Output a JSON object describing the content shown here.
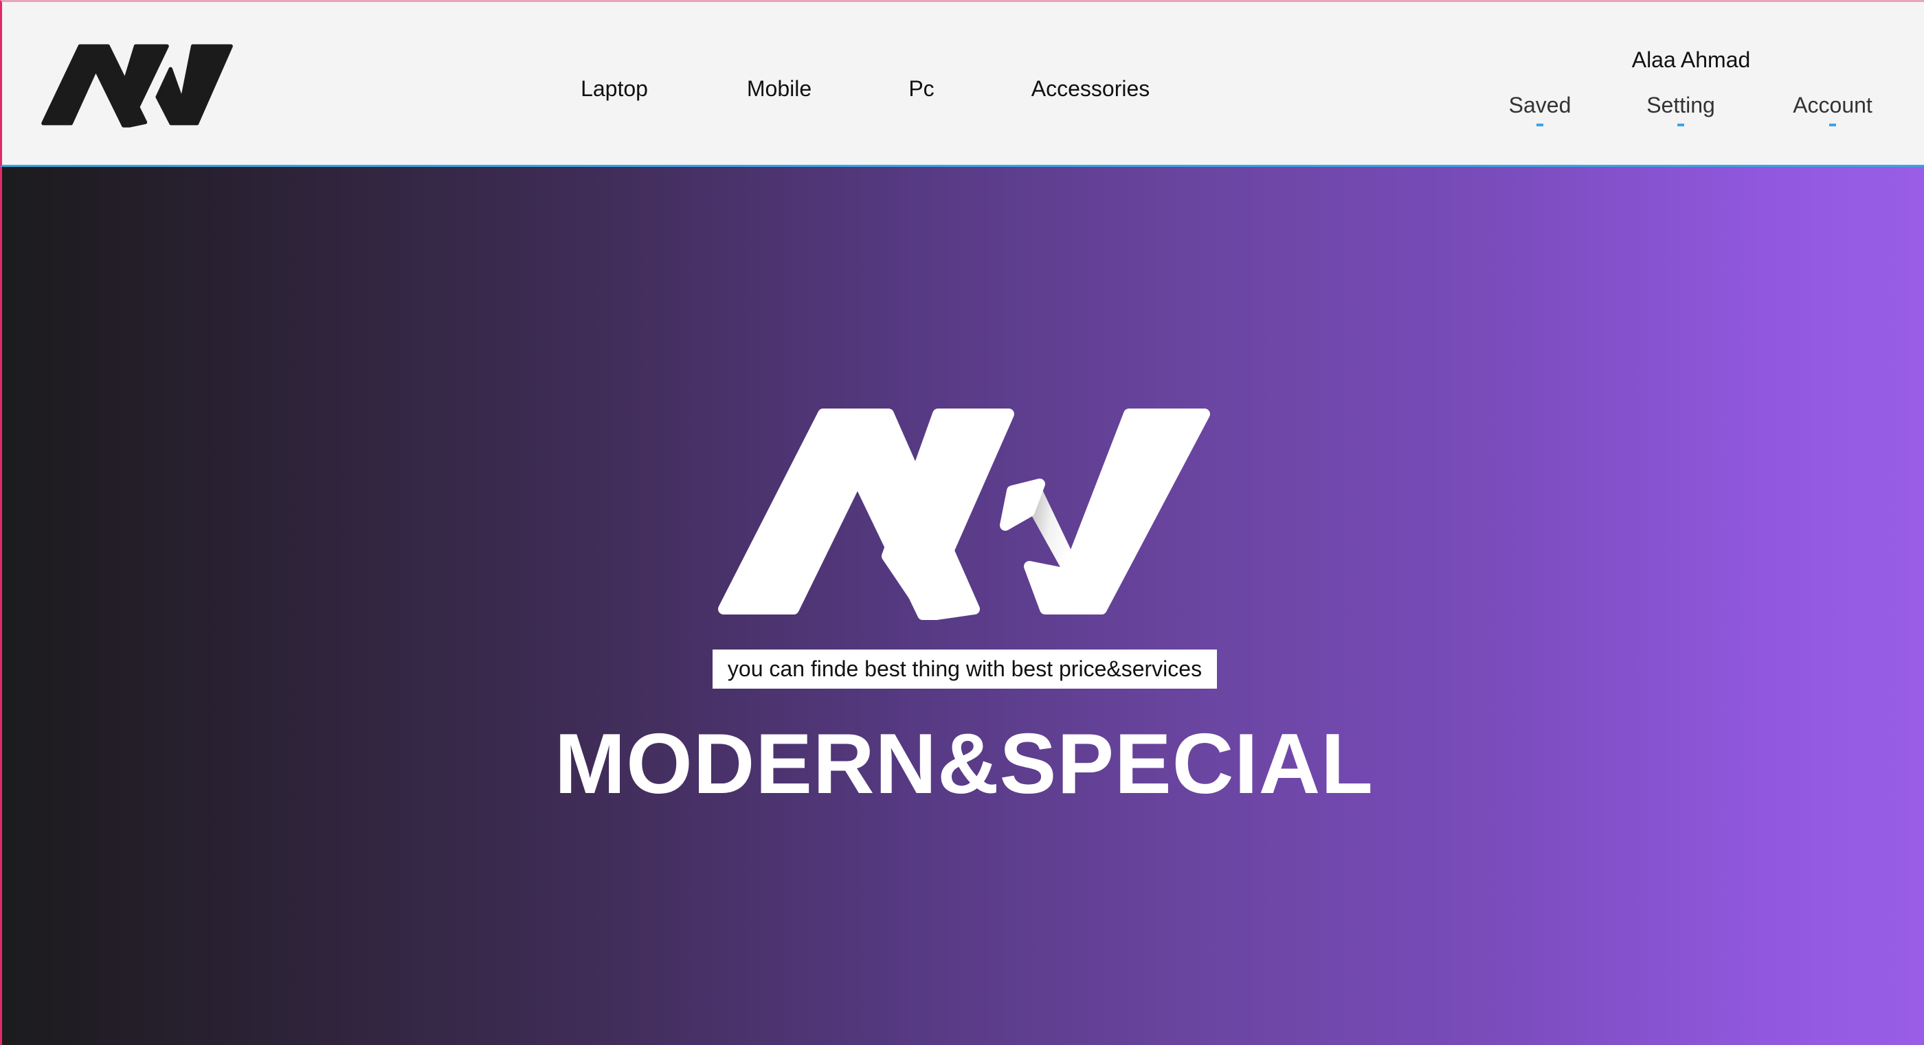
{
  "header": {
    "logo_icon": "nw-logo-icon",
    "nav": [
      {
        "label": "Laptop"
      },
      {
        "label": "Mobile"
      },
      {
        "label": "Pc"
      },
      {
        "label": "Accessories"
      }
    ],
    "user": {
      "name": "Alaa Ahmad",
      "links": [
        {
          "label": "Saved"
        },
        {
          "label": "Setting"
        },
        {
          "label": "Account"
        }
      ]
    }
  },
  "hero": {
    "logo_icon": "nw-logo-icon",
    "tagline": "you can finde best thing with best price&services",
    "title": "MODERN&SPECIAL"
  },
  "colors": {
    "header_bg": "#f4f4f4",
    "hero_gradient_start": "#1c1c1e",
    "hero_gradient_end": "#9a5ee6",
    "accent_underline": "#3aa6e8",
    "logo_dark": "#1b1b1b",
    "logo_light": "#ffffff"
  }
}
